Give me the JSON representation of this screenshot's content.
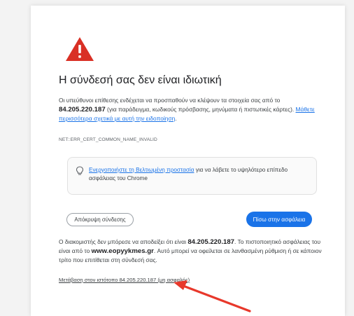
{
  "page": {
    "title": "Η σύνδεσή σας δεν είναι ιδιωτική",
    "intro_prefix": "Οι υπεύθυνοι επίθεσης ενδέχεται να προσπαθούν να κλέψουν τα στοιχεία σας από το",
    "intro_host": "84.205.220.187",
    "intro_suffix": "(για παράδειγμα, κωδικούς πρόσβασης, μηνύματα ή πιστωτικές κάρτες).",
    "learn_more_link": "Μάθετε περισσότερα σχετικά με αυτή την ειδοποίηση",
    "learn_more_end": ".",
    "error_code": "NET::ERR_CERT_COMMON_NAME_INVALID"
  },
  "promo": {
    "link": "Ενεργοποιήστε τη Βελτιωμένη προστασία",
    "text": "για να λάβετε το υψηλότερο επίπεδο ασφάλειας του Chrome"
  },
  "buttons": {
    "hide_details": "Απόκρυψη σύνδεσης",
    "back_to_safety": "Πίσω στην ασφάλεια"
  },
  "details": {
    "prefix": "Ο διακομιστής δεν μπόρεσε να αποδείξει ότι είναι",
    "host": "84.205.220.187",
    "middle": ". Το πιστοποιητικό ασφάλειας του είναι από το",
    "cert_domain": "www.eopyykmes.gr",
    "suffix": ". Αυτό μπορεί να οφείλεται σε λανθασμένη ρύθμιση ή σε κάποιον τρίτο που επιτίθεται στη σύνδεσή σας.",
    "proceed_link": "Μετάβαση στον ιστότοπο 84.205.220.187 (μη ασφαλής)"
  },
  "colors": {
    "warning_red": "#d93025",
    "accent_blue": "#1a73e8",
    "arrow_red": "#e8382b"
  },
  "icons": {
    "warning": "warning-triangle-icon",
    "bulb": "lightbulb-icon",
    "annotation": "red-arrow-annotation"
  }
}
